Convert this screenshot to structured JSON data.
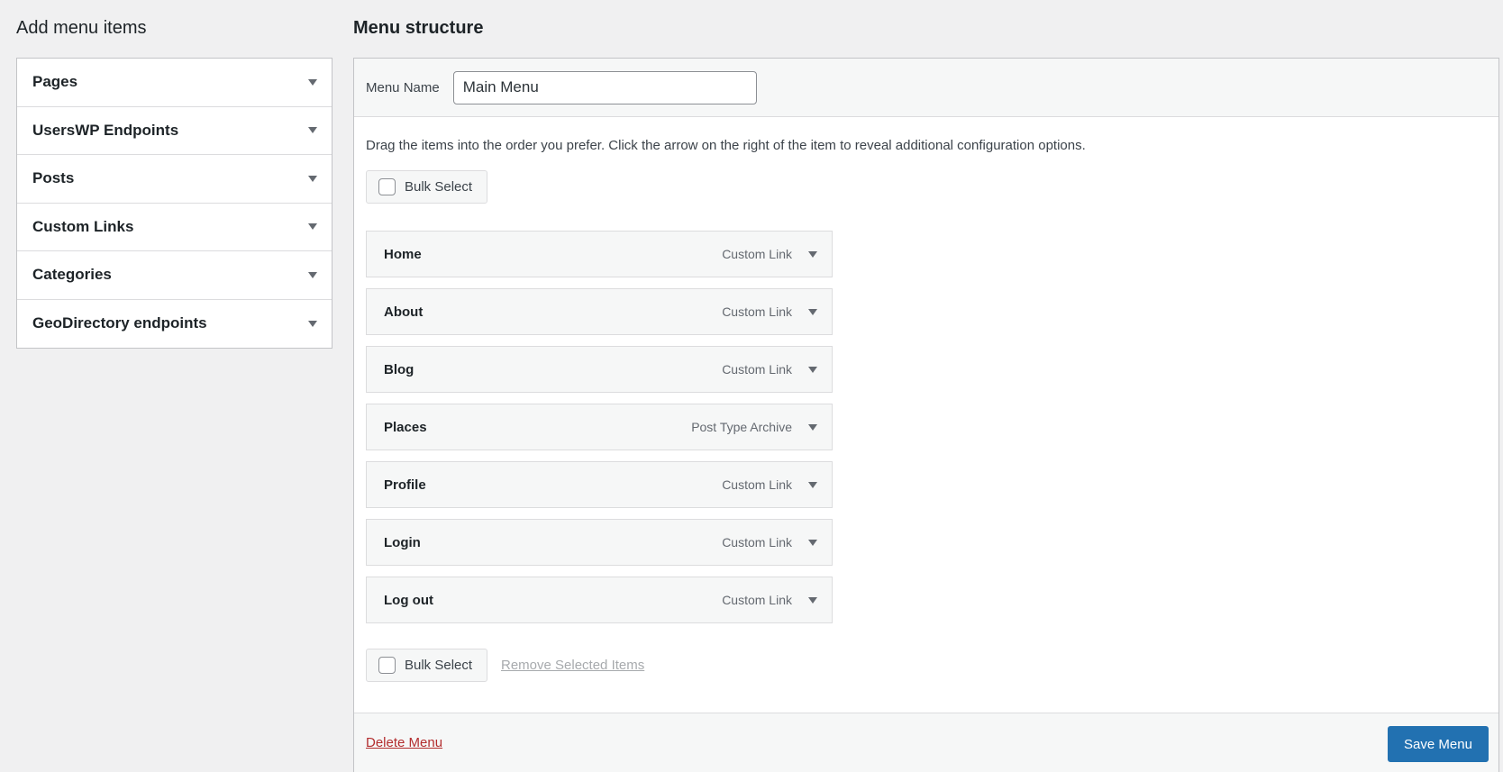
{
  "left": {
    "title": "Add menu items",
    "panels": [
      {
        "label": "Pages"
      },
      {
        "label": "UsersWP Endpoints"
      },
      {
        "label": "Posts"
      },
      {
        "label": "Custom Links"
      },
      {
        "label": "Categories"
      },
      {
        "label": "GeoDirectory endpoints"
      }
    ]
  },
  "right": {
    "title": "Menu structure",
    "menu_name_label": "Menu Name",
    "menu_name_value": "Main Menu",
    "instructions": "Drag the items into the order you prefer. Click the arrow on the right of the item to reveal additional configuration options.",
    "bulk_select_label": "Bulk Select",
    "items": [
      {
        "title": "Home",
        "type": "Custom Link"
      },
      {
        "title": "About",
        "type": "Custom Link"
      },
      {
        "title": "Blog",
        "type": "Custom Link"
      },
      {
        "title": "Places",
        "type": "Post Type Archive"
      },
      {
        "title": "Profile",
        "type": "Custom Link"
      },
      {
        "title": "Login",
        "type": "Custom Link"
      },
      {
        "title": "Log out",
        "type": "Custom Link"
      }
    ],
    "remove_selected_label": "Remove Selected Items",
    "delete_menu_label": "Delete Menu",
    "save_menu_label": "Save Menu"
  },
  "colors": {
    "accent": "#2271b1",
    "danger": "#b32d2e",
    "background": "#f0f0f1"
  },
  "icons": {
    "panel_toggle": "triangle-down-icon",
    "item_toggle": "triangle-down-icon"
  }
}
